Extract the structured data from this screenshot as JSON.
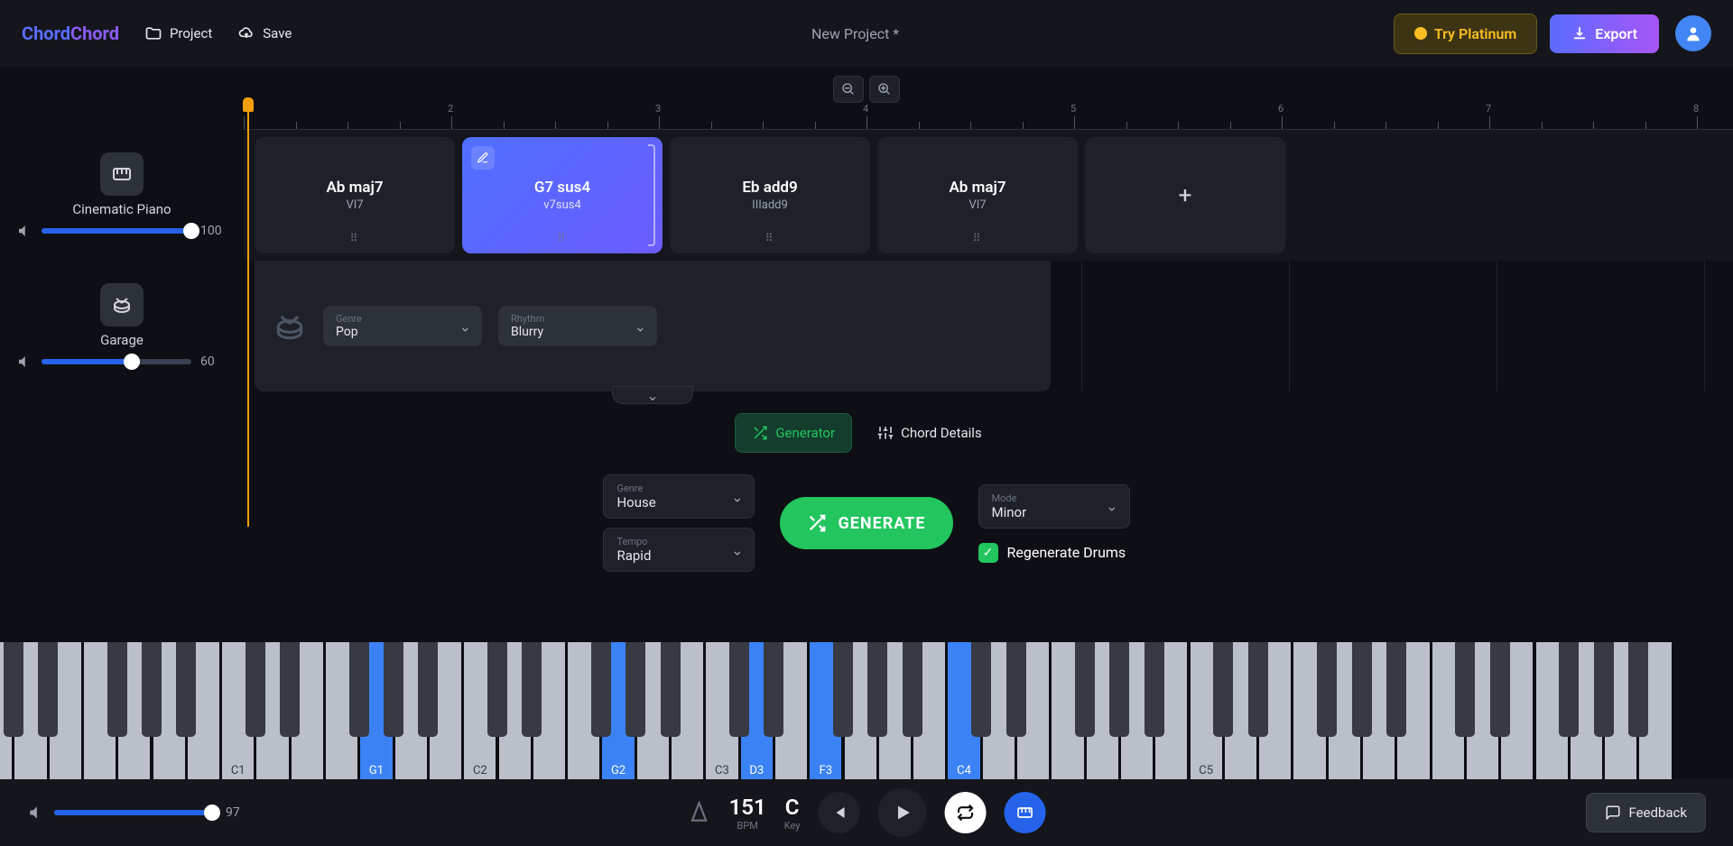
{
  "header": {
    "logo1": "Chord",
    "logo2": "Chord",
    "project_btn": "Project",
    "save_btn": "Save",
    "title": "New Project *",
    "try_platinum": "Try Platinum",
    "export": "Export"
  },
  "tracks": [
    {
      "name": "Cinematic Piano",
      "volume": 100,
      "icon": "piano"
    },
    {
      "name": "Garage",
      "volume": 60,
      "icon": "drums"
    }
  ],
  "ruler_numbers": [
    "2",
    "3",
    "4",
    "5",
    "6",
    "7",
    "8"
  ],
  "chords": [
    {
      "name": "Ab maj7",
      "roman": "VI7",
      "active": false
    },
    {
      "name": "G7 sus4",
      "roman": "v7sus4",
      "active": true
    },
    {
      "name": "Eb add9",
      "roman": "IIIadd9",
      "active": false
    },
    {
      "name": "Ab maj7",
      "roman": "VI7",
      "active": false
    }
  ],
  "drum": {
    "genre_label": "Genre",
    "genre_value": "Pop",
    "rhythm_label": "Rhythm",
    "rhythm_value": "Blurry"
  },
  "mode_tabs": {
    "generator": "Generator",
    "details": "Chord Details"
  },
  "generator": {
    "genre_label": "Genre",
    "genre_value": "House",
    "tempo_label": "Tempo",
    "tempo_value": "Rapid",
    "mode_label": "Mode",
    "mode_value": "Minor",
    "button": "GENERATE",
    "regen_label": "Regenerate Drums"
  },
  "piano": {
    "highlighted": [
      "G1",
      "G2",
      "D3",
      "F3",
      "C4"
    ],
    "octave_labels": [
      "C1",
      "C2",
      "C3",
      "C4",
      "C5"
    ]
  },
  "bottom": {
    "volume": 97,
    "bpm": "151",
    "bpm_label": "BPM",
    "key": "C",
    "key_label": "Key",
    "feedback": "Feedback"
  }
}
